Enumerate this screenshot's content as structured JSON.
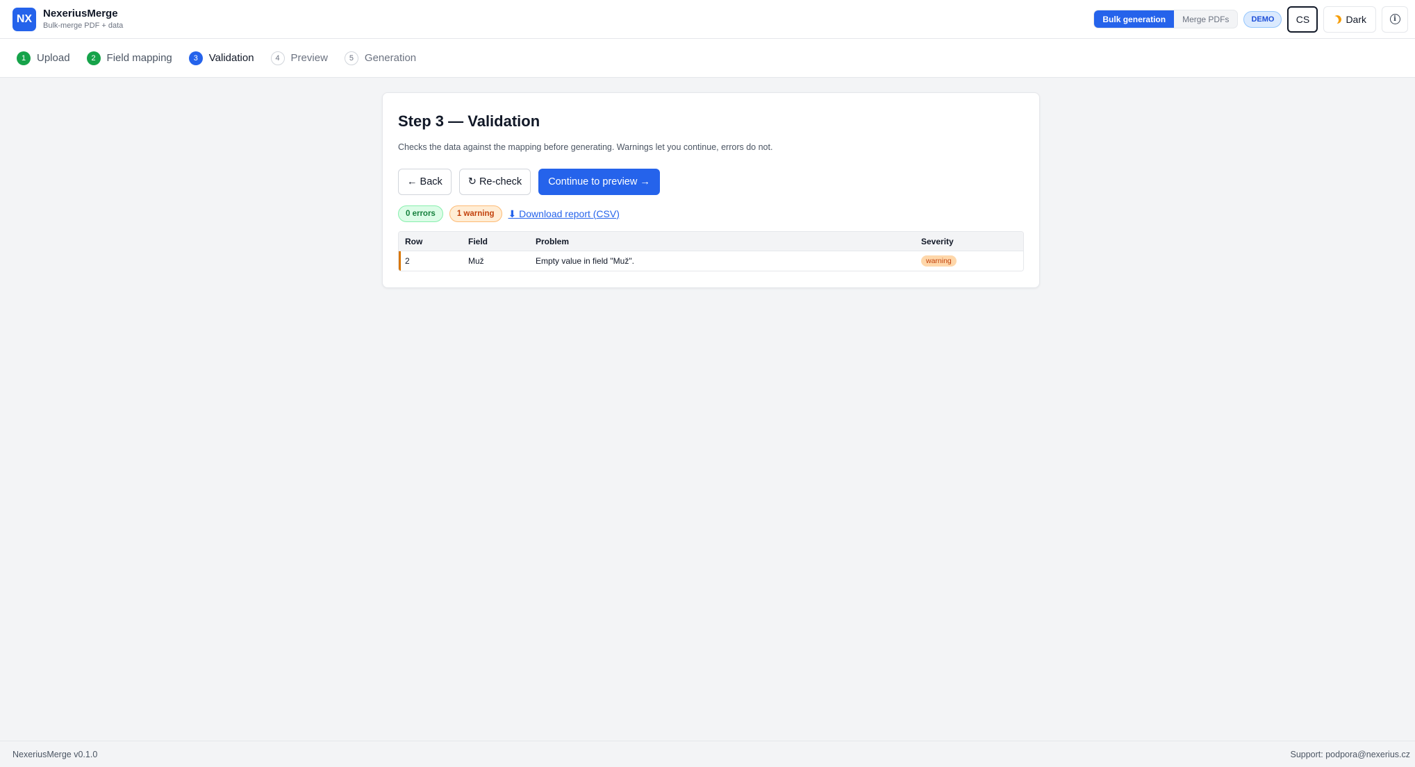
{
  "app": {
    "logo_text": "NX",
    "name": "NexeriusMerge",
    "subtitle": "Bulk-merge PDF + data"
  },
  "header": {
    "modes": [
      "Bulk generation",
      "Merge PDFs"
    ],
    "active_mode": "Bulk generation",
    "demo_label": "DEMO",
    "language": "CS",
    "theme_label": "Dark",
    "info_icon": "i"
  },
  "steps": [
    {
      "num": "1",
      "label": "Upload",
      "state": "done"
    },
    {
      "num": "2",
      "label": "Field mapping",
      "state": "done"
    },
    {
      "num": "3",
      "label": "Validation",
      "state": "current"
    },
    {
      "num": "4",
      "label": "Preview",
      "state": "todo"
    },
    {
      "num": "5",
      "label": "Generation",
      "state": "todo"
    }
  ],
  "main": {
    "title": "Step 3 — Validation",
    "description": "Checks the data against the mapping before generating. Warnings let you continue, errors do not.",
    "back_label": "← Back",
    "recheck_label": "↻ Re-check",
    "continue_label": "Continue to preview →",
    "errors_label": "0 errors",
    "warnings_label": "1 warning",
    "report_label": "⬇ Download report (CSV)",
    "table": {
      "headers": [
        "Row",
        "Field",
        "Problem",
        "Severity"
      ],
      "rows": [
        {
          "row": "2",
          "field": "Muž",
          "problem": "Empty value in field \"Muž\".",
          "severity": "warning"
        }
      ]
    }
  },
  "footer": {
    "version": "NexeriusMerge v0.1.0",
    "support": "Support: podpora@nexerius.cz"
  },
  "colors": {
    "accent": "#2563eb",
    "success": "#16a34a",
    "warning": "#d97706"
  }
}
